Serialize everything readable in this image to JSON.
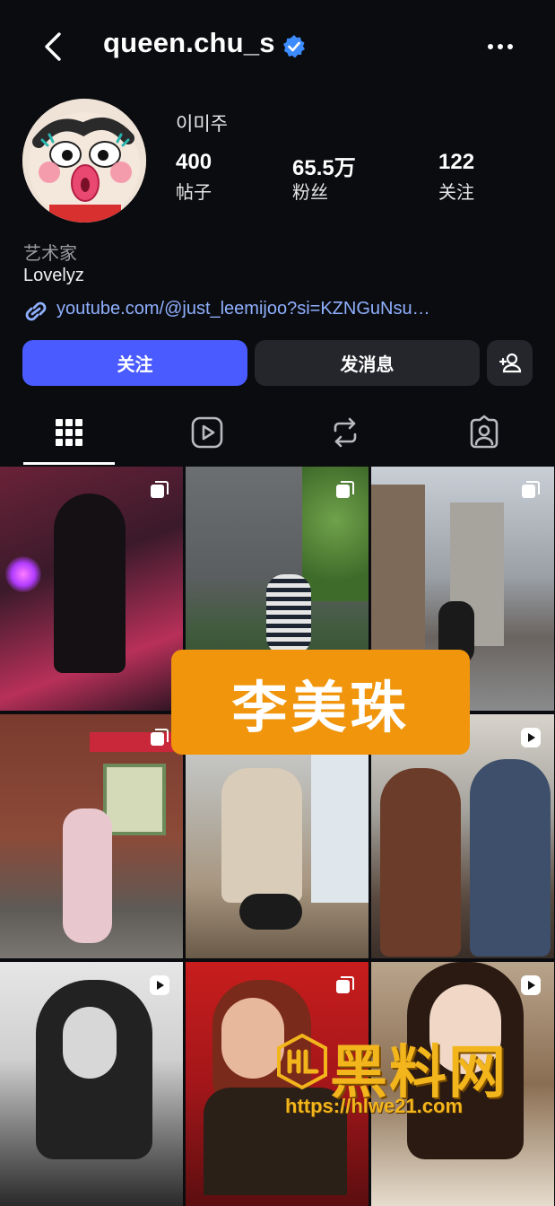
{
  "header": {
    "username": "queen.chu_s"
  },
  "profile": {
    "display_name": "이미주",
    "stats": [
      {
        "value": "400",
        "label": "帖子"
      },
      {
        "value": "65.5万",
        "label": "粉丝"
      },
      {
        "value": "122",
        "label": "关注"
      }
    ],
    "category": "艺术家",
    "bio": "Lovelyz",
    "link": "youtube.com/@just_leemijoo?si=KZNGuNsu…"
  },
  "actions": {
    "follow": "关注",
    "message": "发消息"
  },
  "tabs": [
    "grid-icon",
    "reels-icon",
    "reposts-icon",
    "tagged-icon"
  ],
  "overlay": {
    "banner": "李美珠",
    "watermark_brand": "黑料网",
    "watermark_url": "https://hlwe21.com"
  },
  "colors": {
    "accent": "#4a5cff",
    "banner": "#f0950c",
    "link": "#8fb0ff",
    "watermark": "#f3b51c"
  }
}
